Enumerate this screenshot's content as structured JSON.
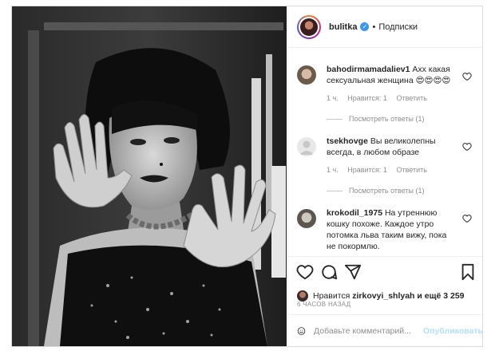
{
  "post": {
    "image_alt": "",
    "header": {
      "username": "bulitka",
      "dot": "•",
      "follow_label": "Подписки"
    },
    "comments": [
      {
        "username": "bahodirmamadaliev1",
        "text": "Ахх какая сексуальная женщина 😍😍😍😍",
        "time": "1 ч.",
        "likes": "Нравится: 1",
        "reply": "Ответить",
        "view_replies": "Посмотреть ответы (1)"
      },
      {
        "username": "tsekhovge",
        "text": "Вы великолепны всегда, в любом образе",
        "time": "1 ч.",
        "likes": "Нравится: 1",
        "reply": "Ответить",
        "view_replies": "Посмотреть ответы (1)"
      },
      {
        "username": "krokodil_1975",
        "text": "На утреннюю кошку похоже. Каждое утро потомка льва таким вижу, пока не покормлю."
      }
    ],
    "likes_prefix": "Нравится",
    "likes_user": "zirkovyi_shlyah",
    "likes_suffix": "и ещё 3 259",
    "timestamp": "6 ЧАСОВ НАЗАД",
    "comment_placeholder": "Добавьте комментарий...",
    "publish_label": "Опубликовать"
  },
  "icons": {
    "like": "heart-icon",
    "comment": "comment-icon",
    "share": "share-icon",
    "save": "bookmark-icon",
    "emoji": "emoji-icon",
    "verified": "verified-badge-icon"
  }
}
